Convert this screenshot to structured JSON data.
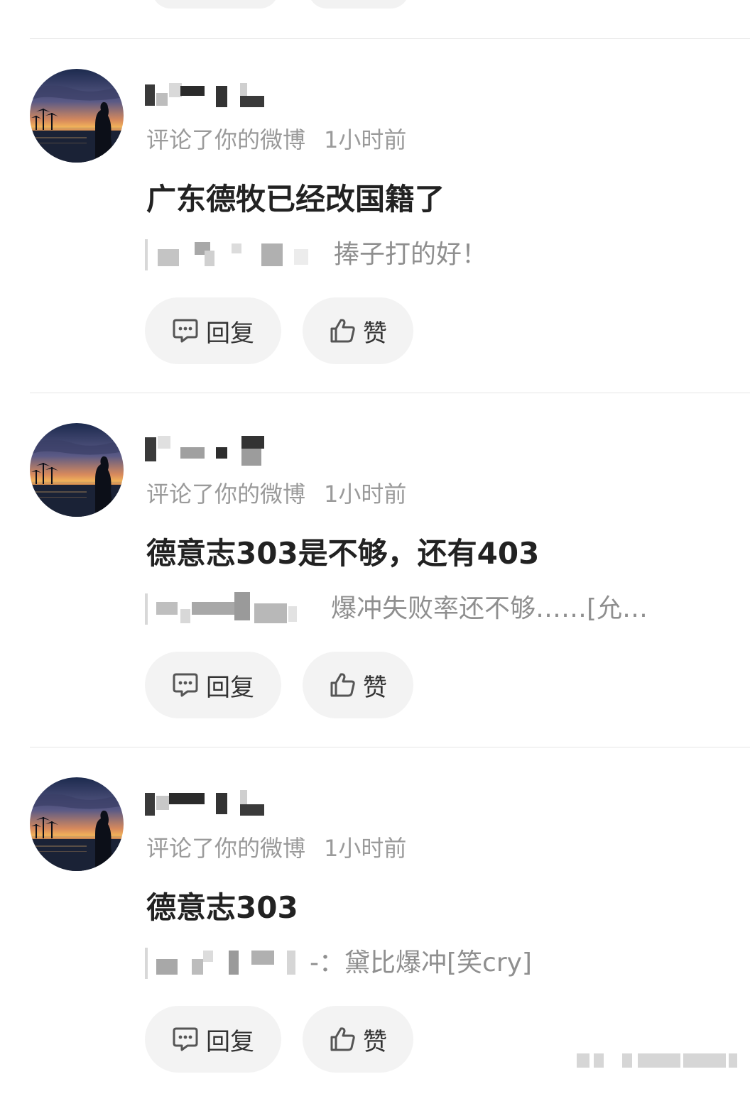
{
  "comments": [
    {
      "action": "评论了你的微博",
      "time": "1小时前",
      "content": "广东德牧已经改国籍了",
      "quoted_text": "捧子打的好！",
      "reply_label": "回复",
      "like_label": "赞"
    },
    {
      "action": "评论了你的微博",
      "time": "1小时前",
      "content": "德意志303是不够，还有403",
      "quoted_text": "爆冲失败率还不够……[允…",
      "reply_label": "回复",
      "like_label": "赞"
    },
    {
      "action": "评论了你的微博",
      "time": "1小时前",
      "content": "德意志303",
      "quoted_text": "-：黛比爆冲[笑cry]",
      "reply_label": "回复",
      "like_label": "赞"
    }
  ],
  "icons": {
    "reply": "comment-bubble-icon",
    "like": "thumbs-up-icon"
  },
  "colors": {
    "meta_text": "#9a9a9a",
    "button_bg": "#f3f3f3",
    "divider": "#e6e6e6"
  }
}
